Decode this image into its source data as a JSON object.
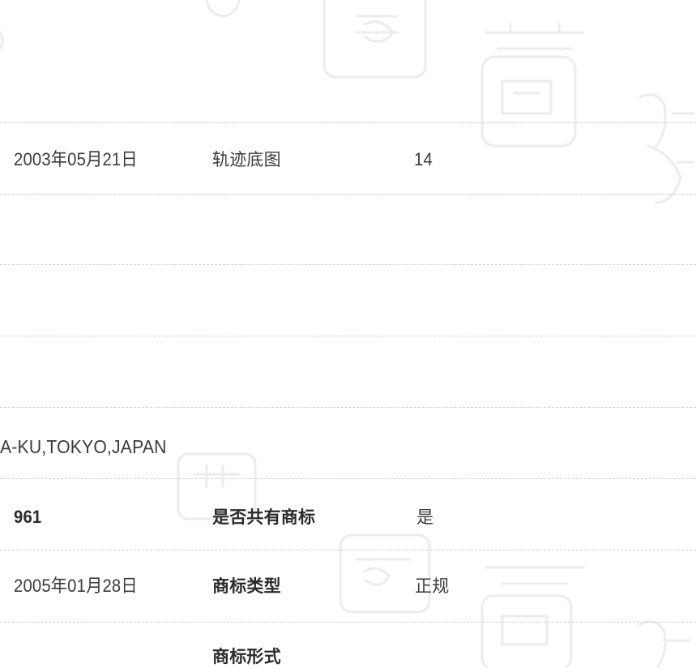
{
  "row_1": {
    "date": "2003年05月21日",
    "label": "轨迹底图",
    "value": "14"
  },
  "address_fragment": "A-KU,TOKYO,JAPAN",
  "row_2": {
    "value": "961",
    "label": "是否共有商标",
    "answer": "是"
  },
  "row_3": {
    "date": "2005年01月28日",
    "label": "商标类型",
    "value": "正规"
  },
  "row_4": {
    "label": "商标形式"
  }
}
